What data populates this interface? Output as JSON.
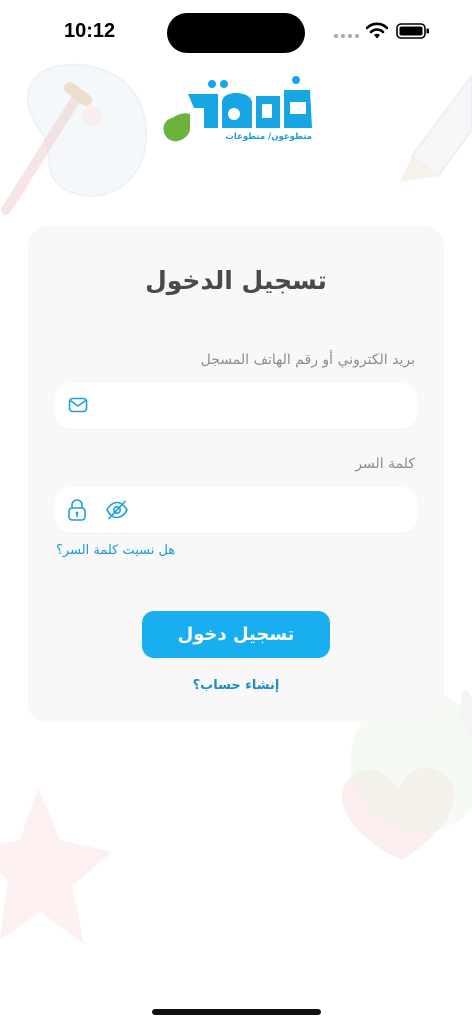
{
  "status_bar": {
    "time": "10:12"
  },
  "logo": {
    "tagline": "متطوعون/ متطوعات"
  },
  "login": {
    "title": "تسجيل الدخول",
    "email_label": "بريد الكتروني أو رقم الهاتف المسجل",
    "email_value": "",
    "password_label": "كلمة السر",
    "password_value": "",
    "forgot_link": "هل نسيت كلمة السر؟",
    "submit_label": "تسجيل دخول",
    "signup_link": "إنشاء حساب؟"
  },
  "icons": {
    "email": "mail-icon",
    "lock": "lock-icon",
    "visibility": "eye-off-icon"
  },
  "colors": {
    "accent": "#18aef0",
    "link": "#1a9ad6",
    "logo_blue": "#16a6e4",
    "logo_green": "#6cb33e"
  }
}
